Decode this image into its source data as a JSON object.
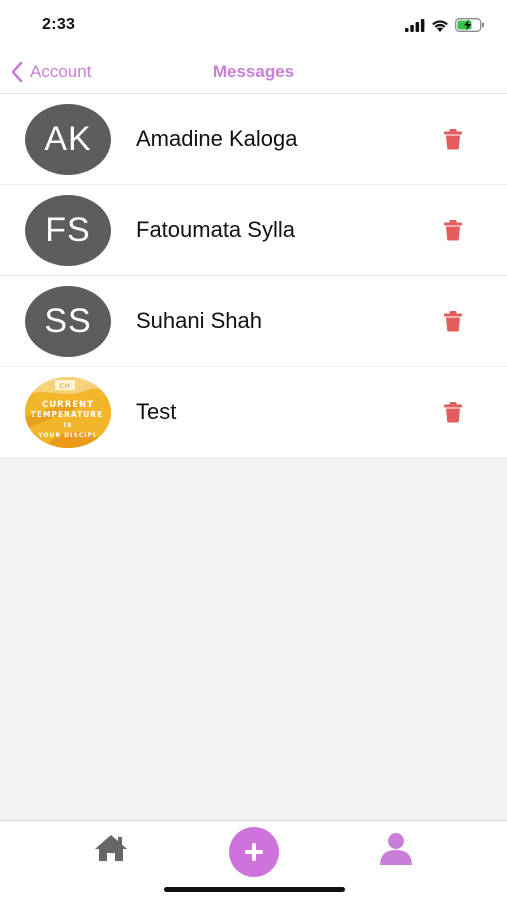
{
  "status_bar": {
    "time": "2:33",
    "icons": [
      "cellular-signal-icon",
      "wifi-icon",
      "battery-charging-icon"
    ]
  },
  "nav": {
    "back_label": "Account",
    "title": "Messages",
    "accent_color": "#c97fd8"
  },
  "conversations": [
    {
      "initials": "AK",
      "name": "Amadine Kaloga",
      "avatar_type": "initials"
    },
    {
      "initials": "FS",
      "name": "Fatoumata Sylla",
      "avatar_type": "initials"
    },
    {
      "initials": "SS",
      "name": "Suhani Shah",
      "avatar_type": "initials"
    },
    {
      "initials": "",
      "name": "Test",
      "avatar_type": "image"
    }
  ],
  "test_avatar_text": "CURRENT TEMPERATURE IS YOUR DISCIPLINE",
  "colors": {
    "delete": "#e35d5d",
    "avatar_bg": "#5d5d5f",
    "tab_add_bg": "#cf73dc",
    "tab_profile": "#c97fd8",
    "tab_home": "#666666"
  },
  "tab_bar": {
    "items": [
      "home-icon",
      "add-icon",
      "profile-icon"
    ]
  }
}
